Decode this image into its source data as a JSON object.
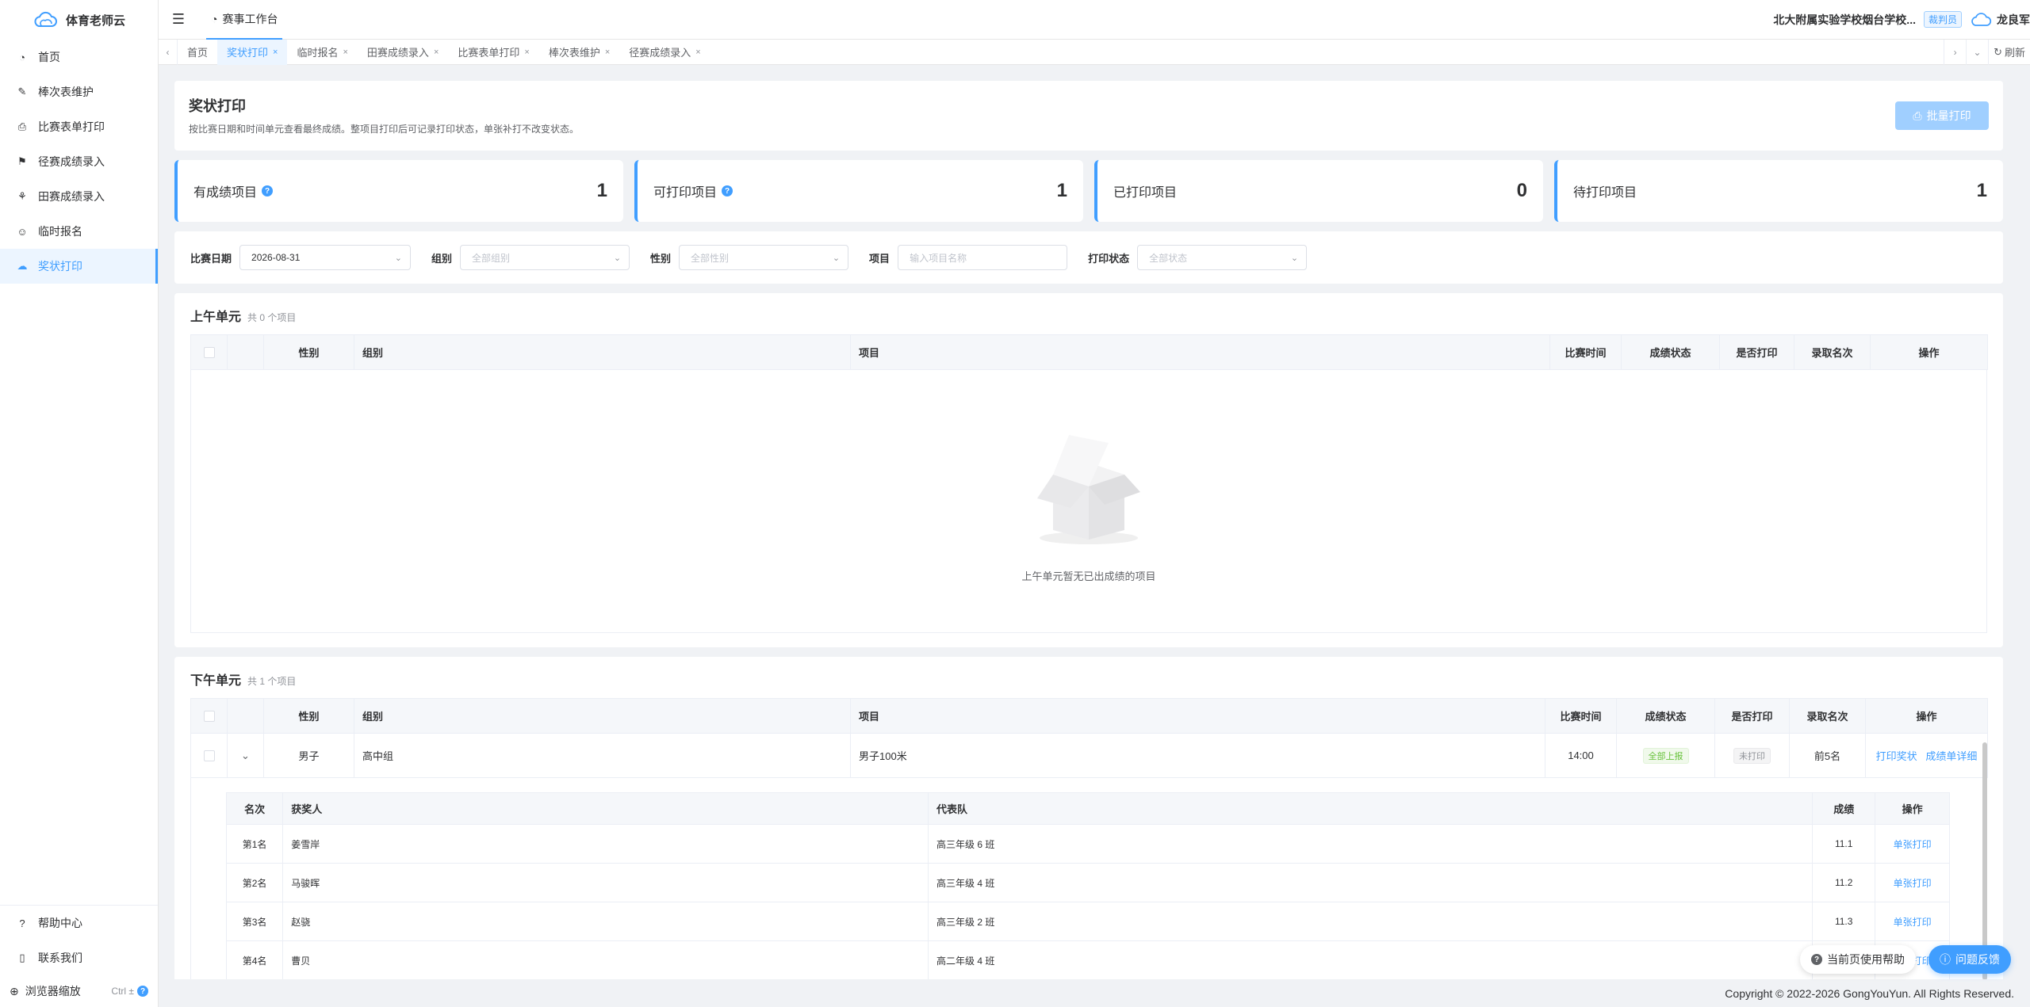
{
  "app": {
    "name": "体育老师云"
  },
  "sidebar": {
    "items": [
      {
        "label": "首页",
        "icon": "dashboard-icon"
      },
      {
        "label": "棒次表维护",
        "icon": "edit-icon"
      },
      {
        "label": "比赛表单打印",
        "icon": "printer-icon"
      },
      {
        "label": "径赛成绩录入",
        "icon": "running-icon"
      },
      {
        "label": "田赛成绩录入",
        "icon": "field-icon"
      },
      {
        "label": "临时报名",
        "icon": "user-add-icon"
      },
      {
        "label": "奖状打印",
        "icon": "award-icon"
      }
    ],
    "bottom": [
      {
        "label": "帮助中心",
        "icon": "help-icon"
      },
      {
        "label": "联系我们",
        "icon": "phone-icon"
      }
    ],
    "zoom_label": "浏览器缩放",
    "zoom_shortcut": "Ctrl ±"
  },
  "header": {
    "workbench_label": "赛事工作台",
    "school": "北大附属实验学校烟台学校...",
    "role": "裁判员",
    "user": "龙良军"
  },
  "tags": [
    {
      "label": "首页",
      "closable": false
    },
    {
      "label": "奖状打印",
      "closable": true
    },
    {
      "label": "临时报名",
      "closable": true
    },
    {
      "label": "田赛成绩录入",
      "closable": true
    },
    {
      "label": "比赛表单打印",
      "closable": true
    },
    {
      "label": "棒次表维护",
      "closable": true
    },
    {
      "label": "径赛成绩录入",
      "closable": true
    }
  ],
  "tags_refresh": "刷新",
  "page": {
    "title": "奖状打印",
    "desc": "按比赛日期和时间单元查看最终成绩。整项目打印后可记录打印状态，单张补打不改变状态。",
    "batch_print": "批量打印"
  },
  "stats": [
    {
      "label": "有成绩项目",
      "value": "1",
      "help": true
    },
    {
      "label": "可打印项目",
      "value": "1",
      "help": true
    },
    {
      "label": "已打印项目",
      "value": "0",
      "help": false
    },
    {
      "label": "待打印项目",
      "value": "1",
      "help": false
    }
  ],
  "filters": {
    "date_label": "比赛日期",
    "date_value": "2026-08-31",
    "group_label": "组别",
    "group_placeholder": "全部组别",
    "gender_label": "性别",
    "gender_placeholder": "全部性别",
    "event_label": "项目",
    "event_placeholder": "输入项目名称",
    "status_label": "打印状态",
    "status_placeholder": "全部状态"
  },
  "columns": [
    "性别",
    "组别",
    "项目",
    "比赛时间",
    "成绩状态",
    "是否打印",
    "录取名次",
    "操作"
  ],
  "morning": {
    "title": "上午单元",
    "count": "共 0 个项目",
    "empty": "上午单元暂无已出成绩的项目"
  },
  "afternoon": {
    "title": "下午单元",
    "count": "共 1 个项目",
    "row": {
      "gender": "男子",
      "group": "高中组",
      "event": "男子100米",
      "time": "14:00",
      "status": "全部上报",
      "printed": "未打印",
      "places": "前5名",
      "action_print": "打印奖状",
      "action_detail": "成绩单详细"
    },
    "sub_columns": [
      "名次",
      "获奖人",
      "代表队",
      "成绩",
      "操作"
    ],
    "winners": [
      {
        "rank": "第1名",
        "name": "姜雪岸",
        "team": "高三年级 6 班",
        "score": "11.1",
        "action": "单张打印"
      },
      {
        "rank": "第2名",
        "name": "马骏晖",
        "team": "高三年级 4 班",
        "score": "11.2",
        "action": "单张打印"
      },
      {
        "rank": "第3名",
        "name": "赵骁",
        "team": "高三年级 2 班",
        "score": "11.3",
        "action": "单张打印"
      },
      {
        "rank": "第4名",
        "name": "曹贝",
        "team": "高二年级 4 班",
        "score": "",
        "action": "单张打印"
      }
    ]
  },
  "footer": "Copyright © 2022-2026 GongYouYun. All Rights Reserved.",
  "float": {
    "help": "当前页使用帮助",
    "feedback": "问题反馈"
  },
  "colors": {
    "primary": "#409eff",
    "success": "#67c23a",
    "muted": "#909399"
  }
}
